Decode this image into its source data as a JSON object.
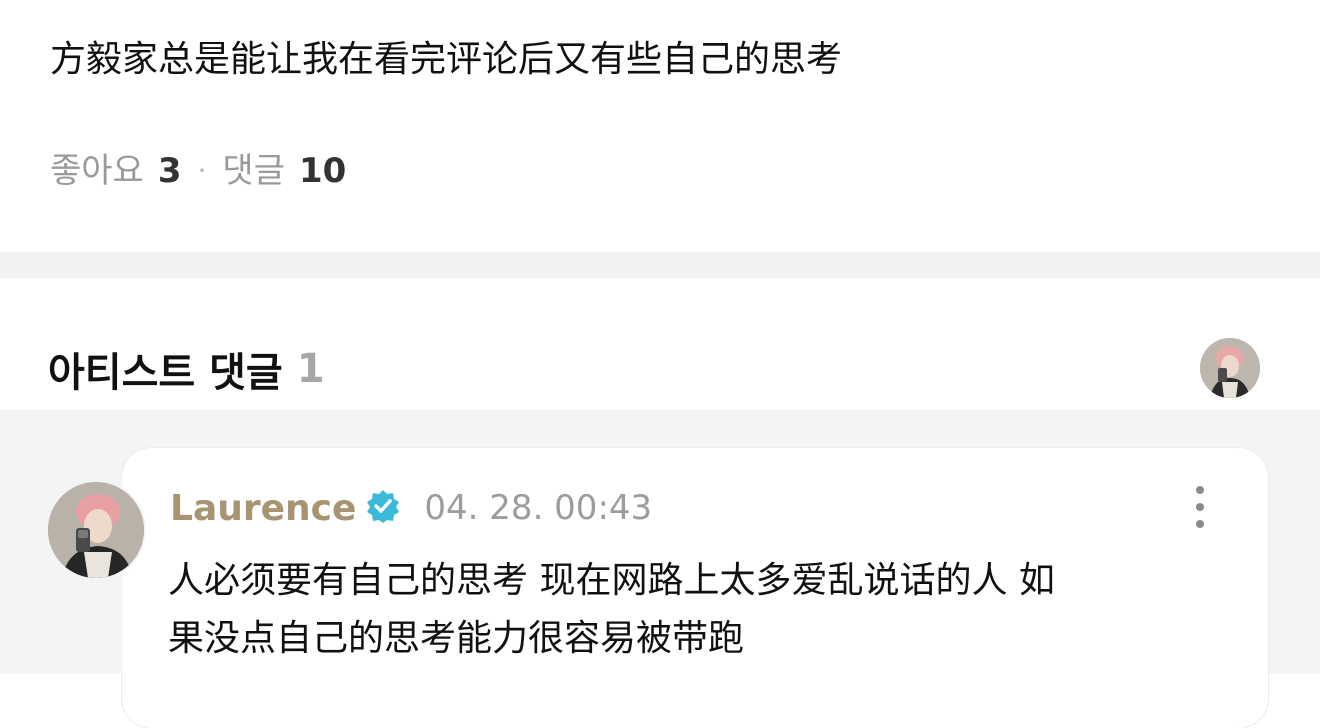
{
  "post": {
    "text": "方毅家总是能让我在看完评论后又有些自己的思考",
    "likes_label": "좋아요",
    "likes_count": "3",
    "separator": "·",
    "comments_label": "댓글",
    "comments_count": "10"
  },
  "artist_comments": {
    "title": "아티스트 댓글",
    "count": "1",
    "avatar_icon": "profile-photo-icon"
  },
  "comment": {
    "author": "Laurence",
    "verified_icon": "verified-badge-icon",
    "timestamp": "04. 28. 00:43",
    "text_line1": "人必须要有自己的思考 现在网路上太多爱乱说话的人 如",
    "text_line2": "果没点自己的思考能力很容易被带跑",
    "more_icon": "more-vertical-icon"
  },
  "colors": {
    "author": "#a89470",
    "verified": "#3bb9d8",
    "muted": "#9a9a9a",
    "divider": "#f2f2f2"
  }
}
